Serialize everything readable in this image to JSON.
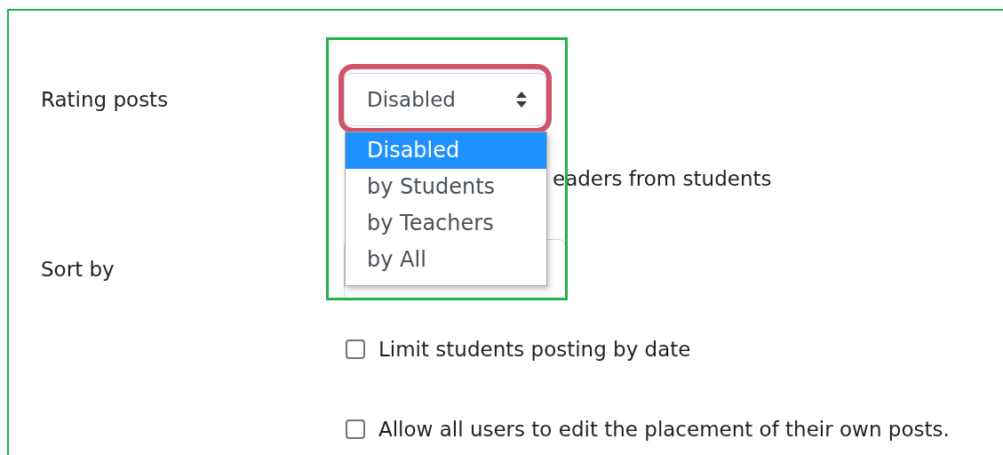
{
  "rating_posts": {
    "label": "Rating posts",
    "value": "Disabled",
    "expanded": true,
    "options": [
      {
        "label": "Disabled",
        "selected": true
      },
      {
        "label": "by Students",
        "selected": false
      },
      {
        "label": "by Teachers",
        "selected": false
      },
      {
        "label": "by All",
        "selected": false
      }
    ]
  },
  "partly_hidden_option": {
    "label": "eaders from students"
  },
  "sort_by": {
    "label": "Sort by"
  },
  "checkboxes": [
    {
      "label": "Limit students posting by date",
      "checked": false
    },
    {
      "label": "Allow all users to edit the placement of their own posts.",
      "checked": false
    }
  ]
}
